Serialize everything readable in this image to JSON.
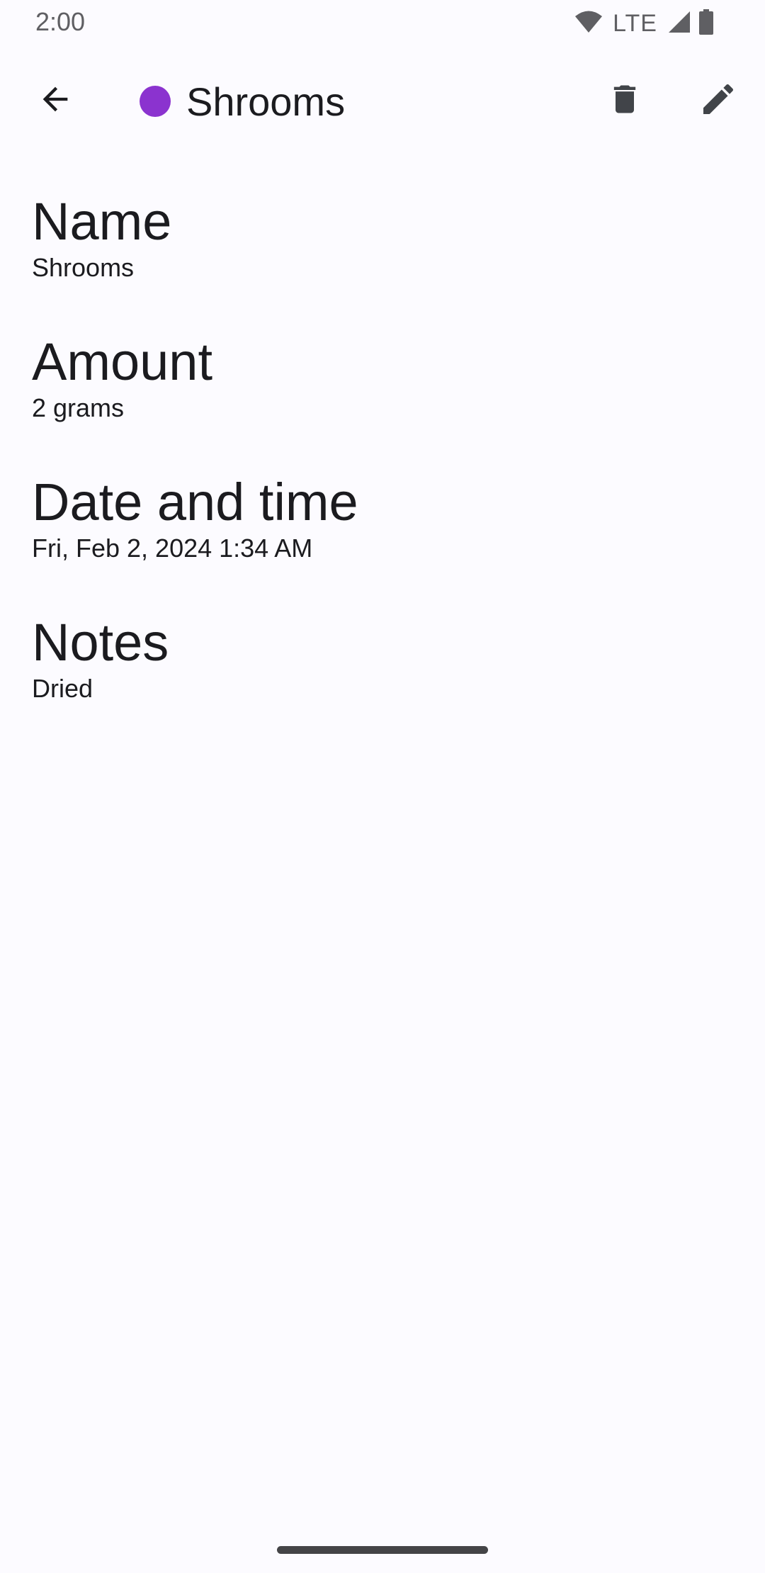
{
  "status_bar": {
    "time": "2:00",
    "network": "LTE",
    "icons": [
      "wifi-icon",
      "cell-signal-icon",
      "battery-icon"
    ]
  },
  "app_bar": {
    "back_icon": "arrow-back-icon",
    "title": "Shrooms",
    "dot_color": "#8b33cf",
    "actions": [
      "delete-icon",
      "edit-icon"
    ]
  },
  "fields": [
    {
      "label": "Name",
      "value": "Shrooms"
    },
    {
      "label": "Amount",
      "value": "2 grams"
    },
    {
      "label": "Date and time",
      "value": "Fri, Feb 2, 2024 1:34 AM"
    },
    {
      "label": "Notes",
      "value": "Dried"
    }
  ],
  "colors": {
    "background": "#fcfbff",
    "text": "#1b1b1f",
    "icon": "#414449",
    "accent": "#8b33cf"
  }
}
